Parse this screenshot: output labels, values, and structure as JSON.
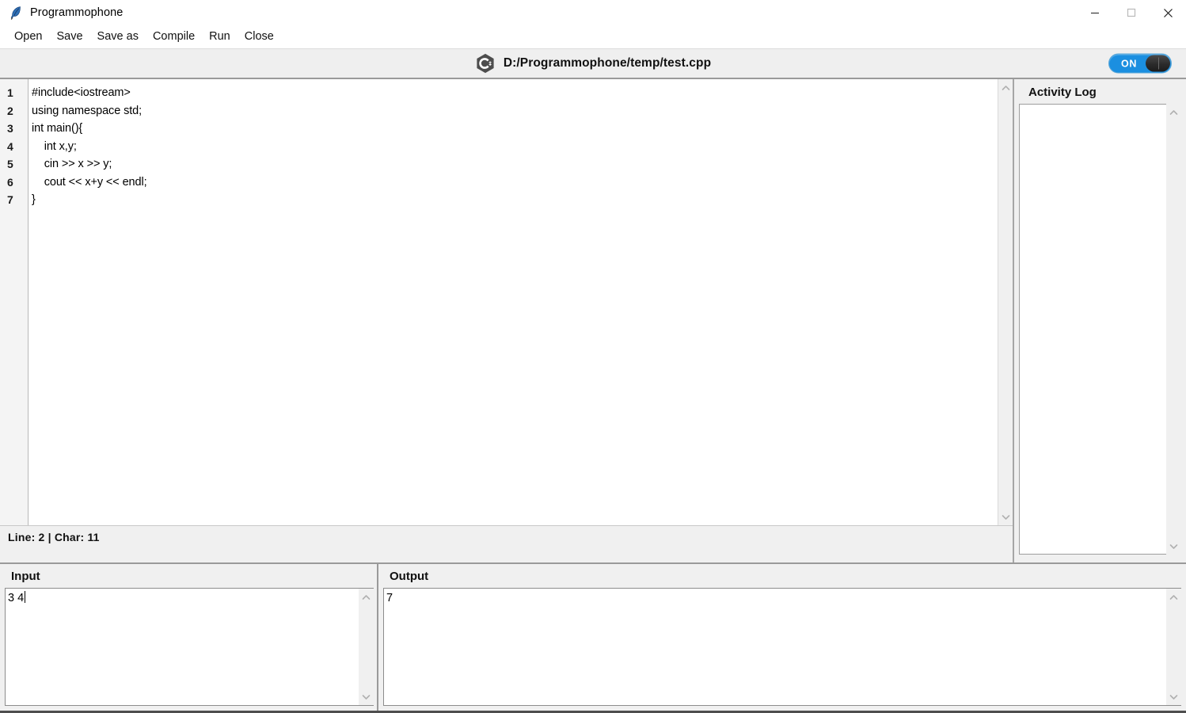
{
  "window": {
    "title": "Programmophone",
    "app_icon": "quill-feather-icon",
    "controls": {
      "minimize": "minimize-icon",
      "maximize": "maximize-icon",
      "close": "close-icon"
    }
  },
  "menubar": {
    "items": [
      {
        "label": "Open"
      },
      {
        "label": "Save"
      },
      {
        "label": "Save as"
      },
      {
        "label": "Compile"
      },
      {
        "label": "Run"
      },
      {
        "label": "Close"
      }
    ]
  },
  "toolbar": {
    "language_icon": "cpp-logo-icon",
    "file_path": "D:/Programmophone/temp/test.cpp",
    "toggle": {
      "label": "ON",
      "state": "on",
      "accent_color": "#1b8fe0"
    }
  },
  "editor": {
    "line_numbers": [
      "1",
      "2",
      "3",
      "4",
      "5",
      "6",
      "7"
    ],
    "code_lines": [
      "#include<iostream>",
      "using namespace std;",
      "int main(){",
      "    int x,y;",
      "    cin >> x >> y;",
      "    cout << x+y << endl;",
      "}"
    ],
    "scroll_up_icon": "chevron-up-icon",
    "scroll_down_icon": "chevron-down-icon"
  },
  "statusbar": {
    "text": "Line: 2 | Char: 11"
  },
  "activity_log": {
    "title": "Activity Log",
    "content": "",
    "scroll_up_icon": "chevron-up-icon",
    "scroll_down_icon": "chevron-down-icon"
  },
  "input_panel": {
    "title": "Input",
    "value": "3 4",
    "scroll_up_icon": "chevron-up-icon",
    "scroll_down_icon": "chevron-down-icon"
  },
  "output_panel": {
    "title": "Output",
    "value": "7",
    "scroll_up_icon": "chevron-up-icon",
    "scroll_down_icon": "chevron-down-icon"
  }
}
